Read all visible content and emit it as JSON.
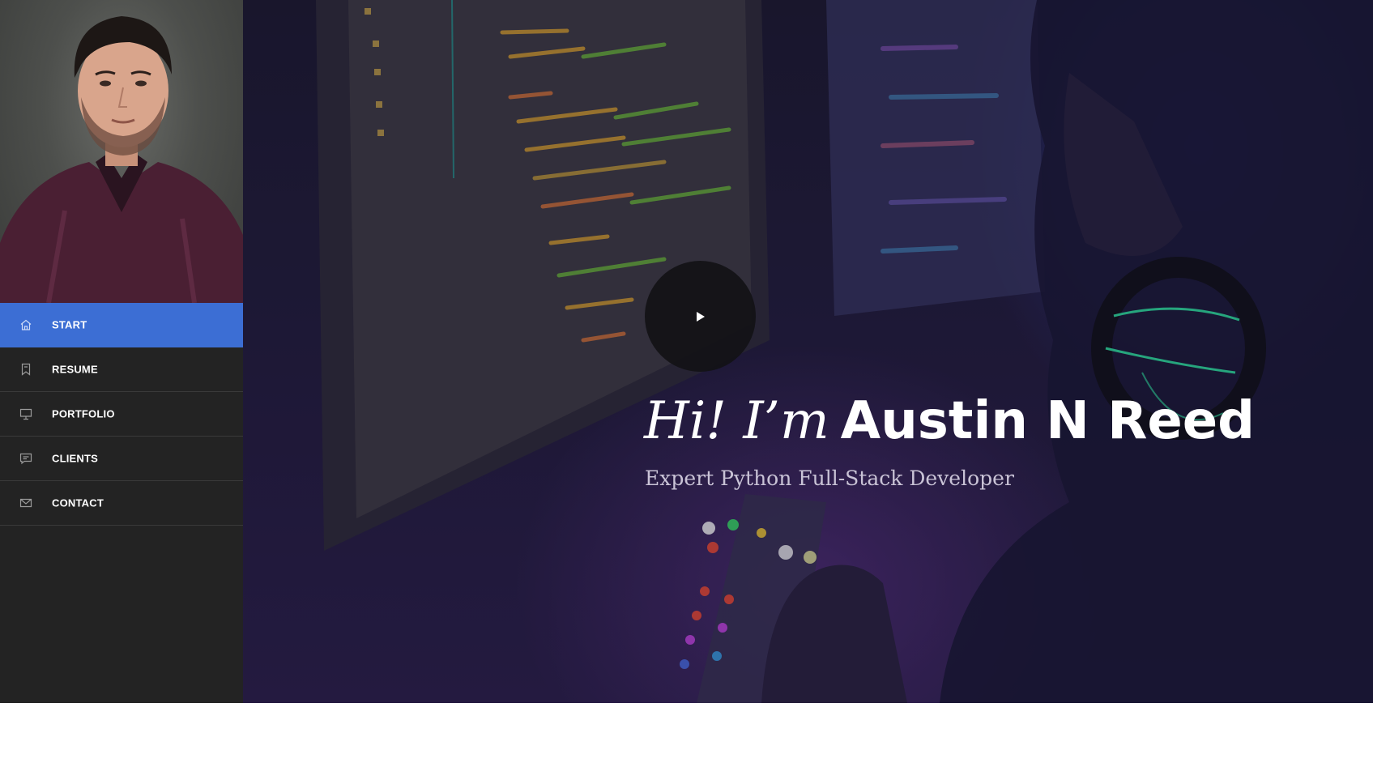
{
  "sidebar": {
    "avatar_alt": "profile-photo",
    "items": [
      {
        "label": "START",
        "icon": "home-icon",
        "active": true
      },
      {
        "label": "RESUME",
        "icon": "bookmark-icon",
        "active": false
      },
      {
        "label": "PORTFOLIO",
        "icon": "monitor-icon",
        "active": false
      },
      {
        "label": "CLIENTS",
        "icon": "chat-icon",
        "active": false
      },
      {
        "label": "CONTACT",
        "icon": "envelope-icon",
        "active": false
      }
    ]
  },
  "hero": {
    "greeting": "Hi! I’m",
    "name": "Austin N Reed",
    "subtitle": "Expert Python Full-Stack Developer",
    "play_icon": "play-icon"
  },
  "colors": {
    "accent": "#3c6ed4",
    "sidebar_bg": "#232323"
  }
}
